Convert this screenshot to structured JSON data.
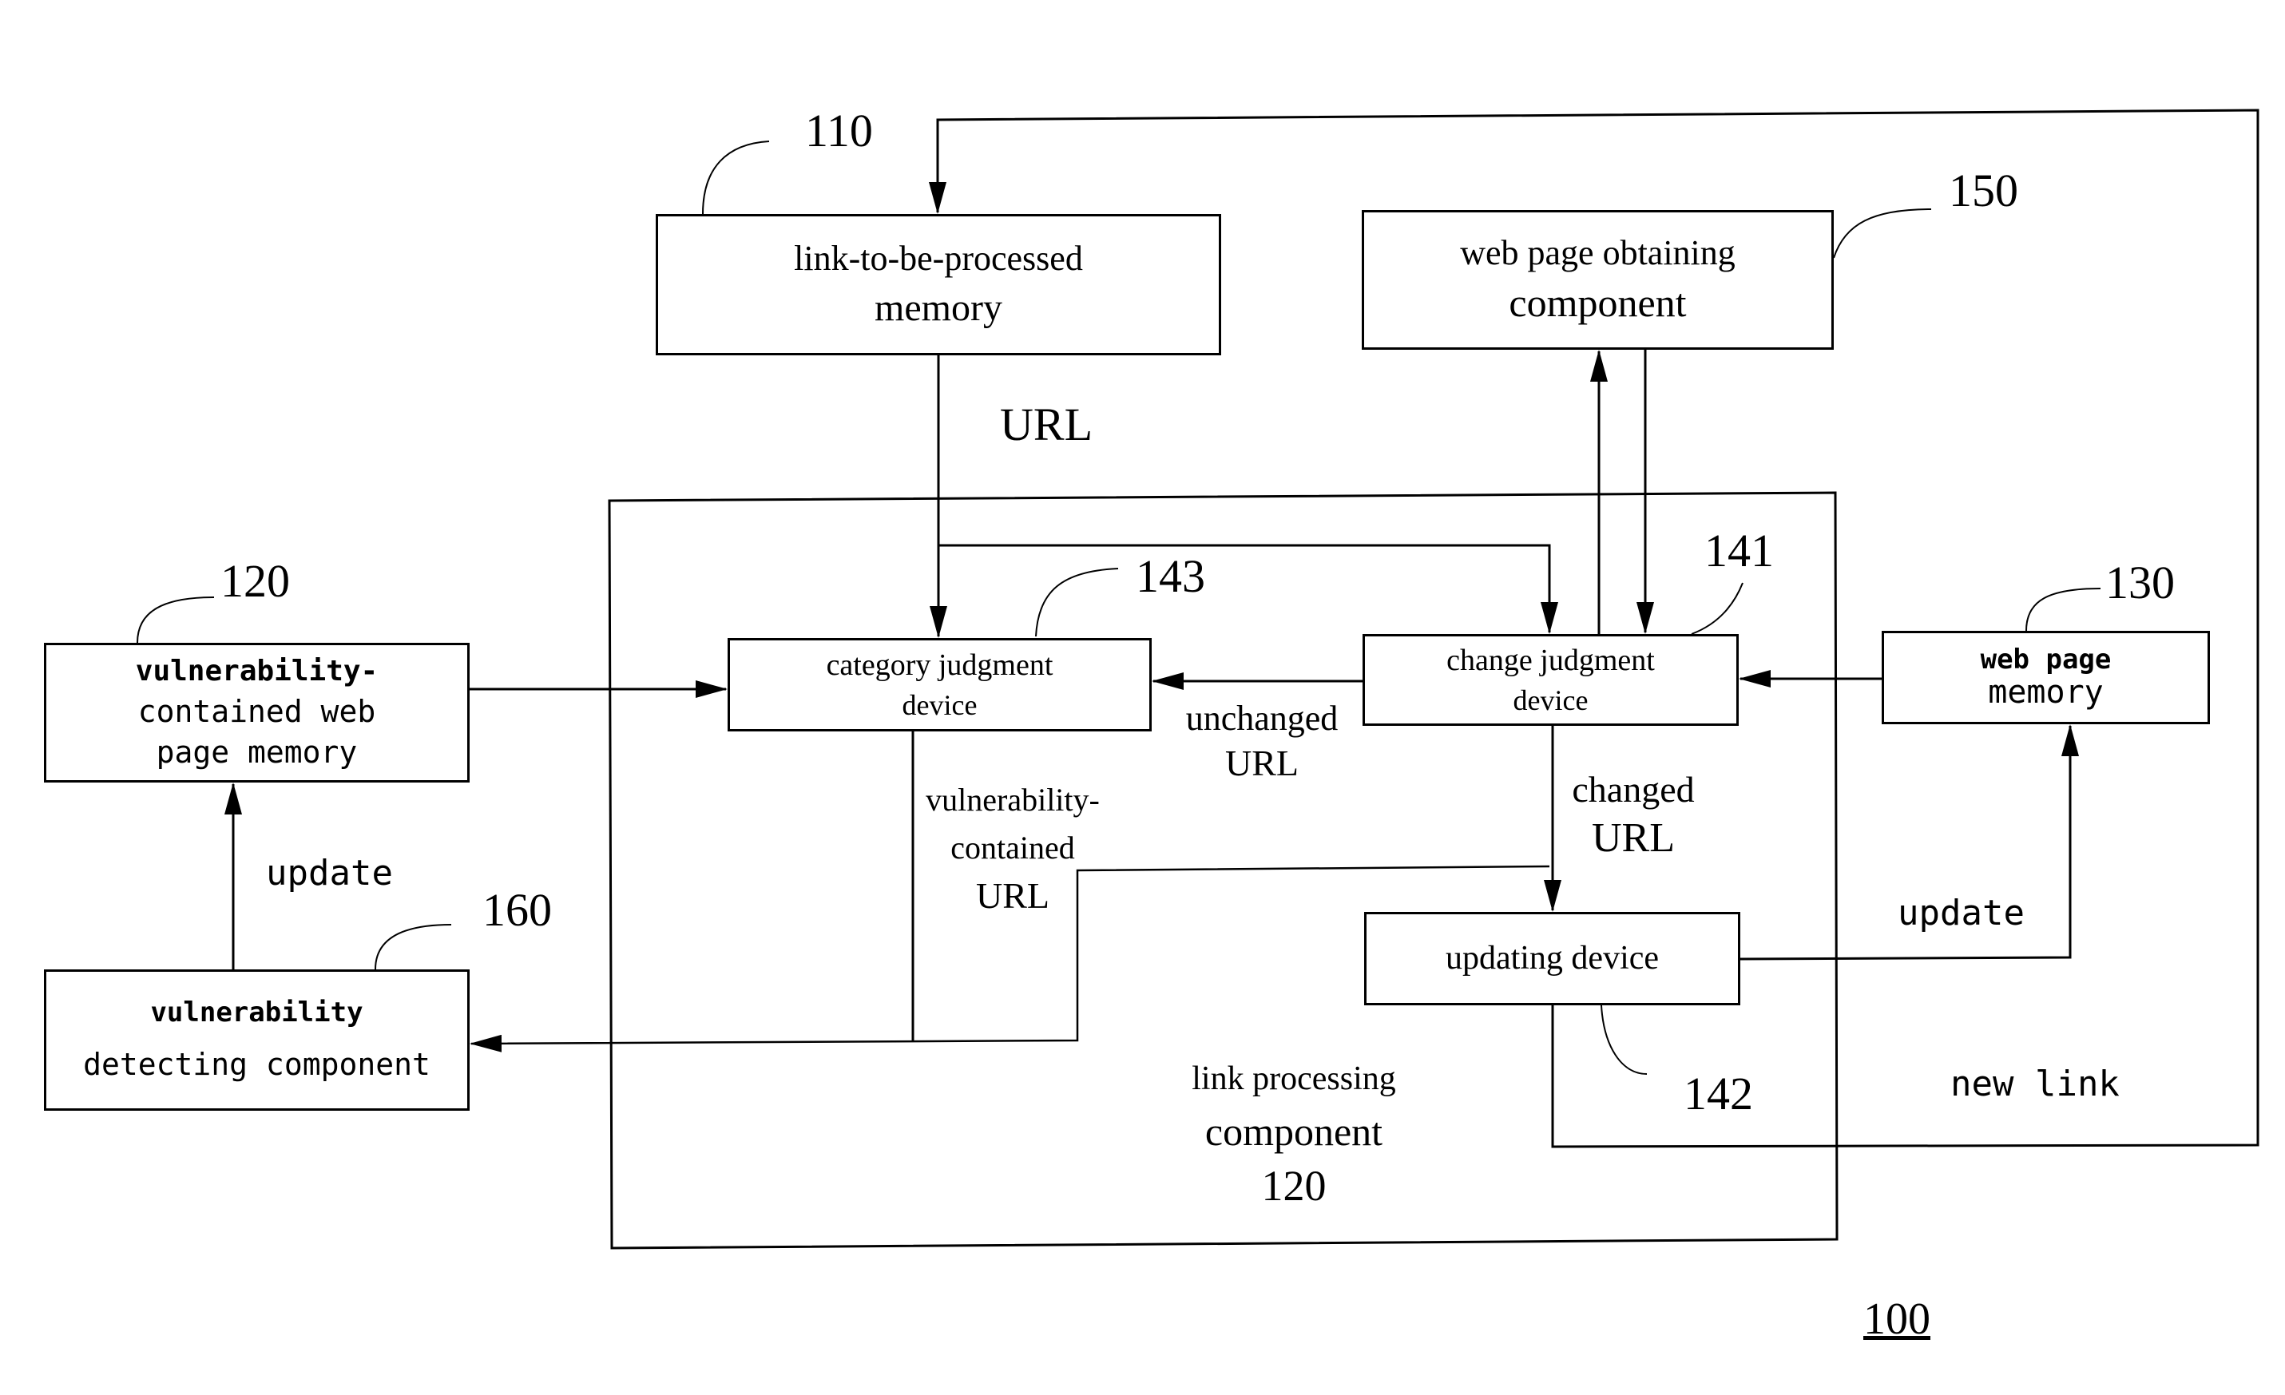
{
  "figure_number": "100",
  "components": {
    "link_memory": {
      "ref": "110",
      "lines": [
        "link-to-be-processed",
        "memory"
      ]
    },
    "web_obtaining": {
      "ref": "150",
      "lines": [
        "web page obtaining",
        "component"
      ]
    },
    "vuln_memory": {
      "ref": "120",
      "lines": [
        "vulnerability-",
        "contained web",
        "page memory"
      ]
    },
    "vuln_detect": {
      "ref": "160",
      "lines": [
        "vulnerability",
        "detecting component"
      ]
    },
    "web_memory": {
      "ref": "130",
      "lines": [
        "web page",
        "memory"
      ]
    },
    "category_judgment": {
      "ref": "143",
      "lines": [
        "category judgment",
        "device"
      ]
    },
    "change_judgment": {
      "ref": "141",
      "lines": [
        "change judgment",
        "device"
      ]
    },
    "updating": {
      "ref": "142",
      "lines": [
        "updating device"
      ]
    },
    "link_processing": {
      "lines": [
        "link processing",
        "component",
        "120"
      ]
    }
  },
  "edge_labels": {
    "url": "URL",
    "unchanged": [
      "unchanged",
      "URL"
    ],
    "changed": [
      "changed",
      "URL"
    ],
    "vuln_url": [
      "vulnerability-",
      "contained",
      "URL"
    ],
    "update_left": "update",
    "update_right": "update",
    "new_link": "new link"
  }
}
